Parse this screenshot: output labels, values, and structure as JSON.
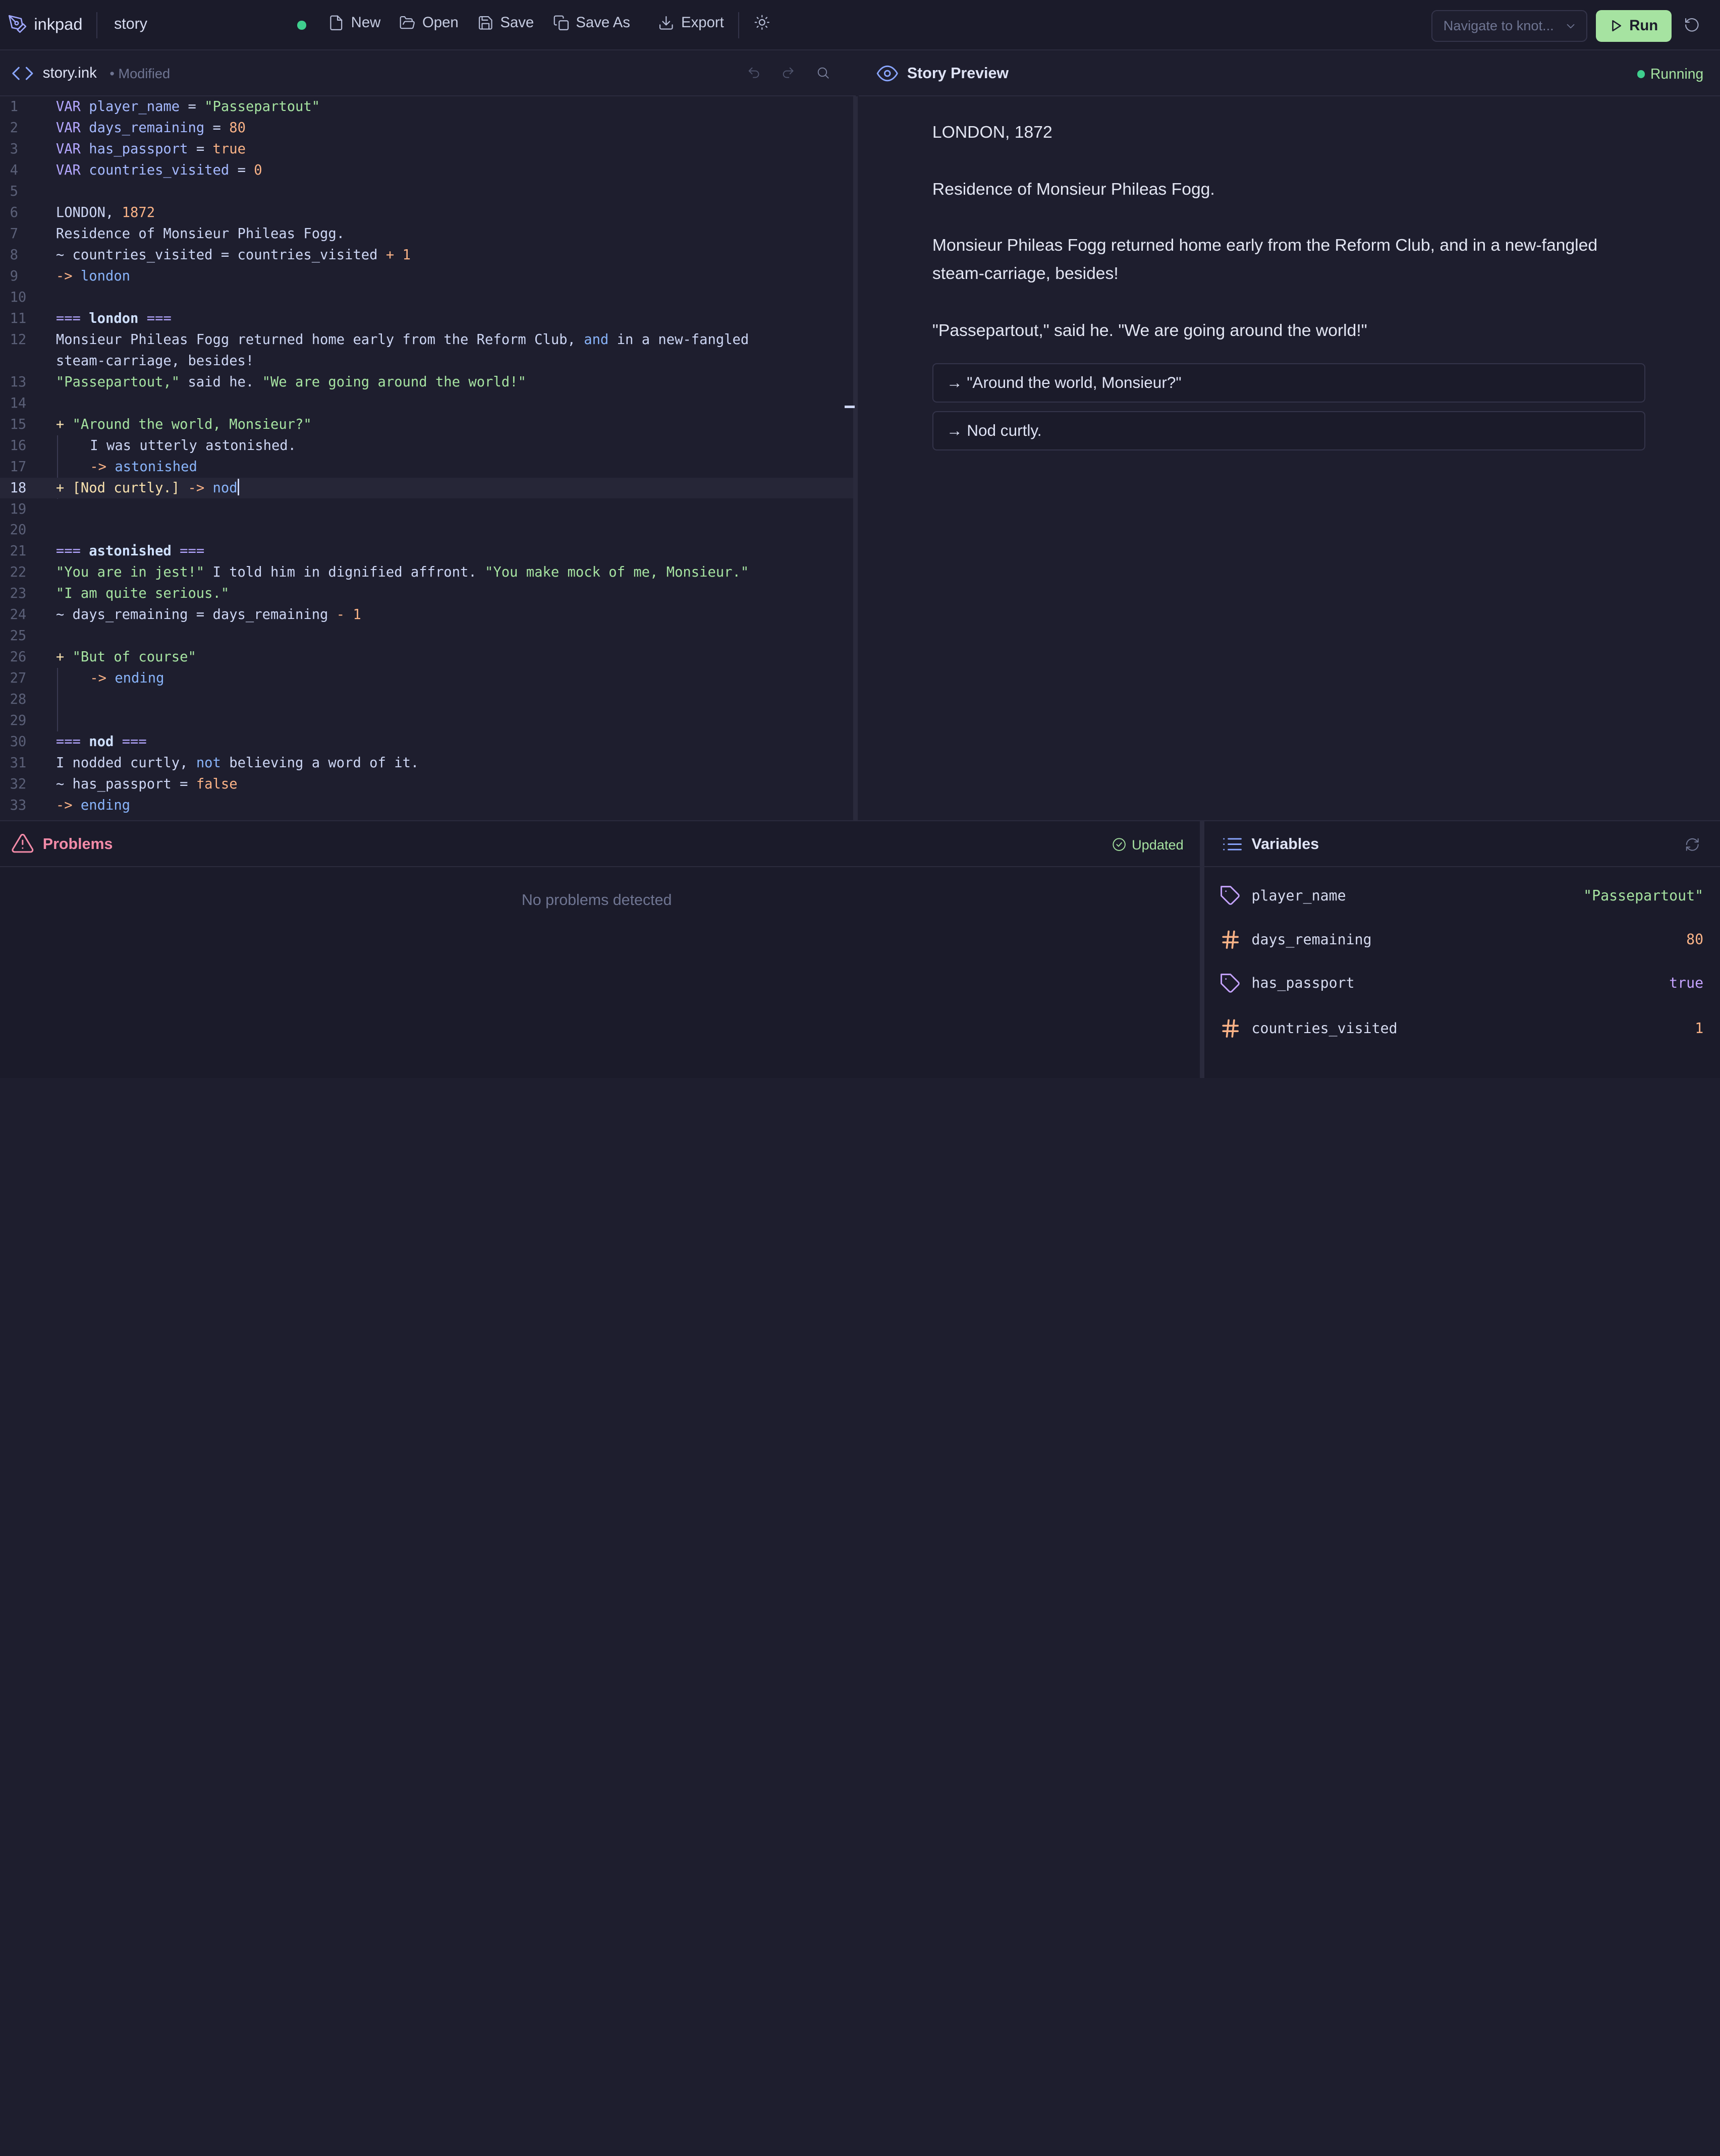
{
  "toolbar": {
    "brand": "inkpad",
    "story_name": "story",
    "new_label": "New",
    "open_label": "Open",
    "save_label": "Save",
    "save_as_label": "Save As",
    "export_label": "Export",
    "navigate_placeholder": "Navigate to knot...",
    "run_label": "Run"
  },
  "editor": {
    "file_name": "story.ink",
    "file_status": "• Modified",
    "active_line": 18,
    "line_numbers": [
      "1",
      "2",
      "3",
      "4",
      "5",
      "6",
      "7",
      "8",
      "9",
      "10",
      "11",
      "12",
      "13",
      "14",
      "15",
      "16",
      "17",
      "18",
      "19",
      "20",
      "21",
      "22",
      "23",
      "24",
      "25",
      "26",
      "27",
      "28",
      "29",
      "30",
      "31",
      "32",
      "33"
    ],
    "code": {
      "l1": {
        "kw": "VAR",
        "var": "player_name",
        "eq": " = ",
        "val": "\"Passepartout\""
      },
      "l2": {
        "kw": "VAR",
        "var": "days_remaining",
        "eq": " = ",
        "val": "80"
      },
      "l3": {
        "kw": "VAR",
        "var": "has_passport",
        "eq": " = ",
        "val": "true"
      },
      "l4": {
        "kw": "VAR",
        "var": "countries_visited",
        "eq": " = ",
        "val": "0"
      },
      "l6": {
        "a": "LONDON, ",
        "b": "1872"
      },
      "l7": "Residence of Monsieur Phileas Fogg.",
      "l8": {
        "a": "~ countries_visited = countries_visited ",
        "op": "+",
        "num": "1"
      },
      "l9": {
        "arrow": "->",
        "target": "london"
      },
      "l11": {
        "eq": "===",
        "name": "london",
        "eq2": "==="
      },
      "l12": {
        "a": "Monsieur Phileas Fogg returned home early from the Reform Club, ",
        "and": "and",
        "b": " in a new-fangled"
      },
      "l12b": "steam-carriage, besides!",
      "l13": {
        "s1": "\"Passepartout,\"",
        "mid": " said he. ",
        "s2": "\"We are going around the world!\""
      },
      "l15": {
        "plus": "+",
        "s": "\"Around the world, Monsieur?\""
      },
      "l16": "I was utterly astonished.",
      "l17": {
        "arrow": "->",
        "target": "astonished"
      },
      "l18": {
        "plus": "+",
        "b": "[Nod curtly.]",
        "arrow": "->",
        "target": "nod"
      },
      "l21": {
        "eq": "===",
        "name": "astonished",
        "eq2": "==="
      },
      "l22": {
        "s1": "\"You are in jest!\"",
        "mid": " I told him in dignified affront. ",
        "s2": "\"You make mock of me, Monsieur.\""
      },
      "l23": "\"I am quite serious.\"",
      "l24": {
        "a": "~ days_remaining = days_remaining ",
        "op": "-",
        "num": "1"
      },
      "l26": {
        "plus": "+",
        "s": "\"But of course\""
      },
      "l27": {
        "arrow": "->",
        "target": "ending"
      },
      "l30": {
        "eq": "===",
        "name": "nod",
        "eq2": "==="
      },
      "l31": {
        "a": "I nodded curtly, ",
        "not": "not",
        "b": " believing a word of it."
      },
      "l32": {
        "a": "~ has_passport = ",
        "val": "false"
      },
      "l33": {
        "arrow": "->",
        "target": "ending"
      }
    }
  },
  "preview": {
    "title": "Story Preview",
    "status": "Running",
    "paragraphs": [
      "LONDON, 1872",
      "Residence of Monsieur Phileas Fogg.",
      "Monsieur Phileas Fogg returned home early from the Reform Club, and in a new-fangled steam-carriage, besides!",
      "\"Passepartout,\" said he. \"We are going around the world!\""
    ],
    "choices": [
      "→ \"Around the world, Monsieur?\"",
      "→ Nod curtly."
    ]
  },
  "problems": {
    "title": "Problems",
    "status": "Updated",
    "empty_text": "No problems detected"
  },
  "variables": {
    "title": "Variables",
    "items": [
      {
        "name": "player_name",
        "value": "\"Passepartout\"",
        "type": "string",
        "color": "#a6e3a1",
        "icon": "tag-icon"
      },
      {
        "name": "days_remaining",
        "value": "80",
        "type": "number",
        "color": "#fab387",
        "icon": "hash-icon"
      },
      {
        "name": "has_passport",
        "value": "true",
        "type": "boolean",
        "color": "#c5a3ff",
        "icon": "tag-icon"
      },
      {
        "name": "countries_visited",
        "value": "1",
        "type": "number",
        "color": "#fab387",
        "icon": "hash-icon"
      }
    ]
  },
  "colors": {
    "accent": "#a6e3a1",
    "running": "#3fcf8e",
    "error": "#f38ba8",
    "link": "#8aa6ff"
  }
}
